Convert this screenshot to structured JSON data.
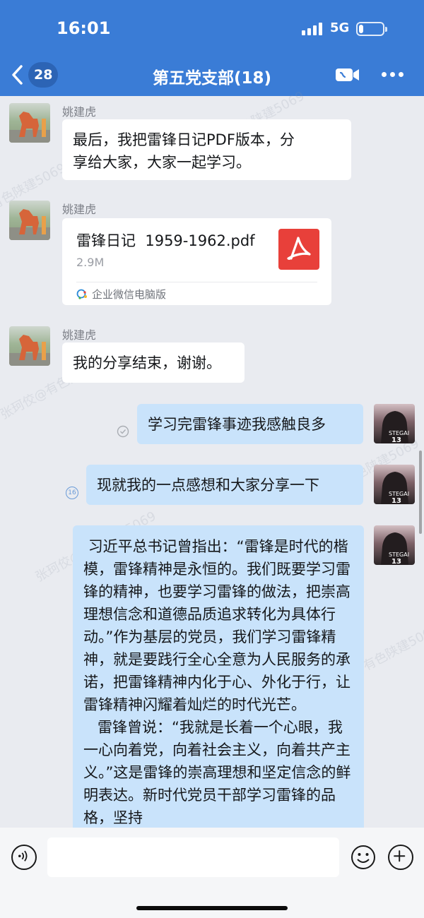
{
  "status_bar": {
    "time": "16:01",
    "network": "5G",
    "battery_level": 0.2
  },
  "header": {
    "back_icon": "chevron-left-icon",
    "unread_count": "28",
    "title": "第五党支部(18)",
    "video_icon": "video-call-icon",
    "more_icon": "more-icon"
  },
  "watermark": [
    "张珂佼@有色陕建5069",
    "有色陕建5069",
    "张珂佼@有色陕建5069"
  ],
  "messages": [
    {
      "sender": "姚建虎",
      "text": "最后，我把雷锋日记PDF版本，分\n享给大家，大家一起学习。"
    },
    {
      "sender": "姚建虎",
      "file": {
        "name": "雷锋日记  1959-1962.pdf",
        "size": "2.9M",
        "source": "企业微信电脑版",
        "icon": "pdf-icon"
      }
    },
    {
      "sender": "姚建虎",
      "text": "我的分享结束，谢谢。"
    },
    {
      "self": true,
      "text": "学习完雷锋事迹我感触良多",
      "status_icon": "read-check-icon"
    },
    {
      "self": true,
      "text": "现就我的一点感想和大家分享一下",
      "read_count": "16"
    },
    {
      "self": true,
      "text": " 习近平总书记曾指出：“雷锋是时代的楷模，雷锋精神是永恒的。我们既要学习雷锋的精神，也要学习雷锋的做法，把崇高理想信念和道德品质追求转化为具体行动。”作为基层的党员，我们学习雷锋精神，就是要践行全心全意为人民服务的承诺，把雷锋精神内化于心、外化于行，让雷锋精神闪耀着灿烂的时代光芒。\n   雷锋曾说：“我就是长着一个心眼，我一心向着党，向着社会主义，向着共产主义。”这是雷锋的崇高理想和坚定信念的鲜明表达。新时代党员干部学习雷锋的品格，坚持"
    }
  ],
  "input_bar": {
    "placeholder": "",
    "voice_icon": "voice-icon",
    "emoji_icon": "emoji-icon",
    "plus_icon": "plus-icon"
  }
}
